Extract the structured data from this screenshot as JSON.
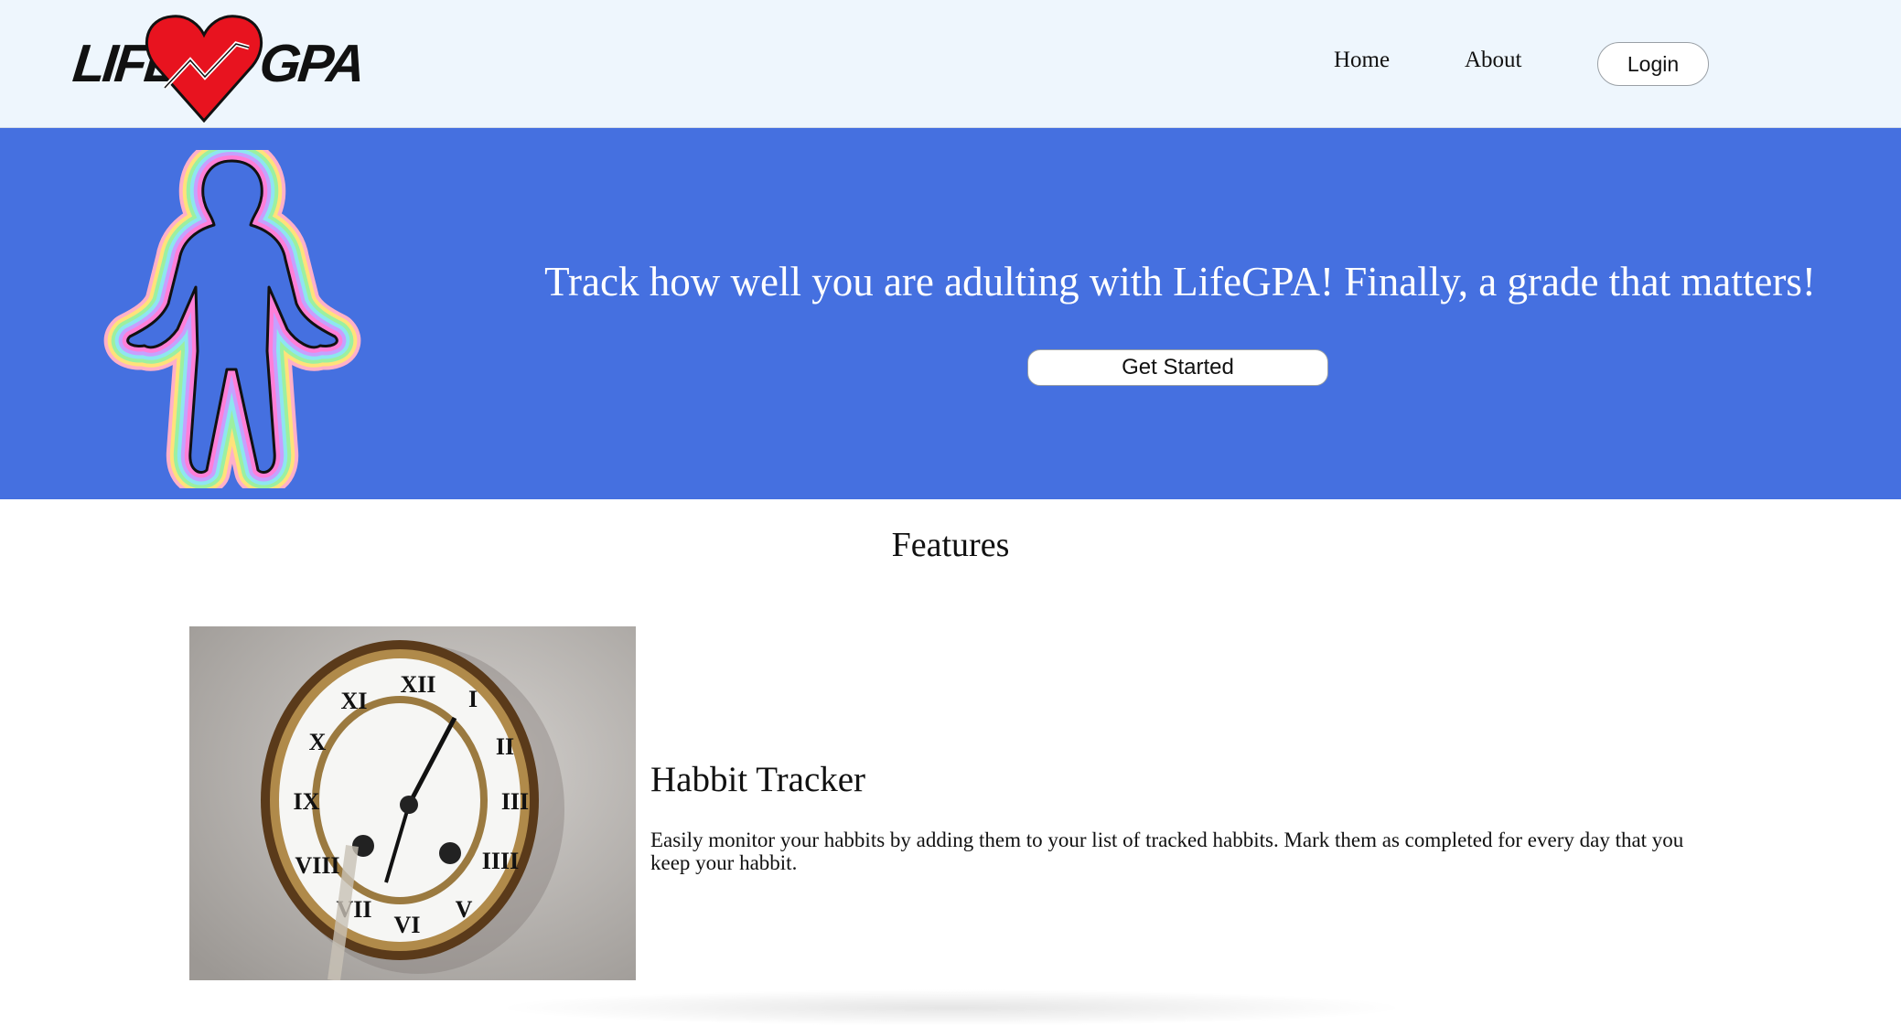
{
  "header": {
    "logo": {
      "left_text": "LIFE",
      "right_text": "GPA",
      "heart_color": "#e8131f"
    },
    "nav": {
      "home": "Home",
      "about": "About"
    },
    "login_label": "Login"
  },
  "hero": {
    "background": "#4570e0",
    "tagline": "Track how well you are adulting with LifeGPA! Finally, a grade that matters!",
    "cta_label": "Get Started",
    "figure_icon": "human-aura-icon"
  },
  "features": {
    "title": "Features",
    "items": [
      {
        "image": "clock-photo",
        "title": "Habbit Tracker",
        "description": "Easily monitor your habbits by adding them to your list of tracked habbits. Mark them as completed for every day that you keep your habbit."
      }
    ]
  }
}
